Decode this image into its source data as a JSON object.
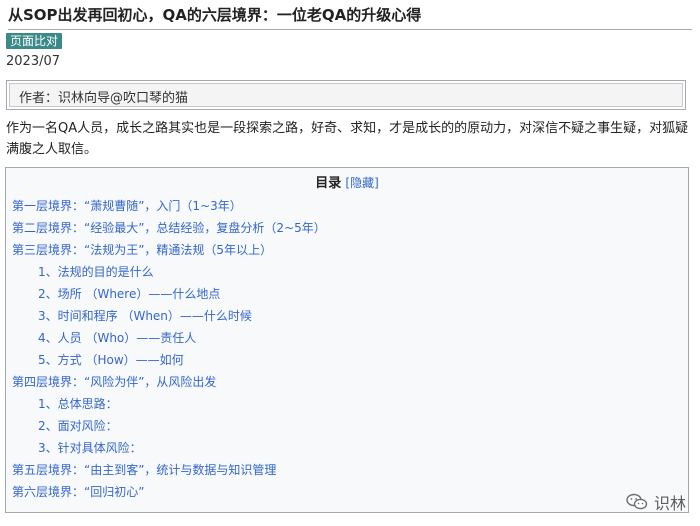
{
  "title": "从SOP出发再回初心，QA的六层境界：一位老QA的升级心得",
  "badge": "页面比对",
  "date": "2023/07",
  "author": "作者：识林向导@吹口琴的猫",
  "intro": "作为一名QA人员，成长之路其实也是一段探索之路，好奇、求知，才是成长的的原动力，对深信不疑之事生疑，对狐疑满腹之人取信。",
  "toc": {
    "title": "目录",
    "toggle": "[隐藏]",
    "items": [
      {
        "label": "第一层境界：“萧规曹随”，入门（1~3年）",
        "level": 1
      },
      {
        "label": "第二层境界：“经验最大”，总结经验，复盘分析（2~5年）",
        "level": 1
      },
      {
        "label": "第三层境界：“法规为王”，精通法规（5年以上）",
        "level": 1
      },
      {
        "label": "1、法规的目的是什么",
        "level": 2
      },
      {
        "label": "2、场所 （Where）——什么地点",
        "level": 2
      },
      {
        "label": "3、时间和程序 （When）——什么时候",
        "level": 2
      },
      {
        "label": "4、人员 （Who）——责任人",
        "level": 2
      },
      {
        "label": "5、方式 （How）——如何",
        "level": 2
      },
      {
        "label": "第四层境界：“风险为伴”，从风险出发",
        "level": 1
      },
      {
        "label": "1、总体思路：",
        "level": 2
      },
      {
        "label": "2、面对风险：",
        "level": 2
      },
      {
        "label": "3、针对具体风险：",
        "level": 2
      },
      {
        "label": "第五层境界：“由主到客”，统计与数据与知识管理",
        "level": 1
      },
      {
        "label": "第六层境界：“回归初心”",
        "level": 1
      }
    ]
  },
  "watermark": {
    "text": "识林",
    "icon": "wechat-icon"
  }
}
